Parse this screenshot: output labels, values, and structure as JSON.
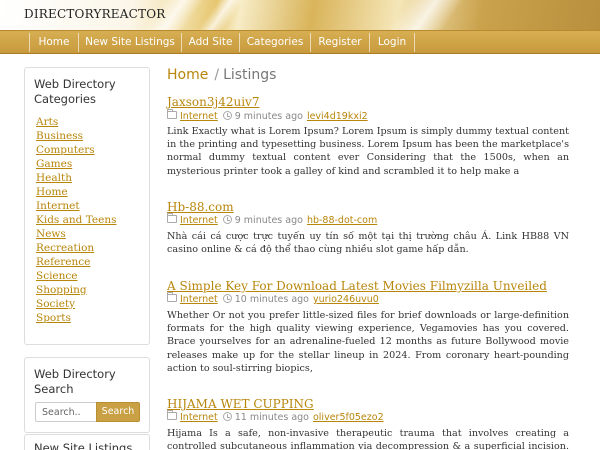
{
  "site": {
    "brand": "DIRECTORYREACTOR"
  },
  "nav": {
    "items": [
      "Home",
      "New Site Listings",
      "Add Site",
      "Categories",
      "Register",
      "Login"
    ]
  },
  "sidebar": {
    "categories_title_line1": "Web Directory",
    "categories_title_line2": "Categories",
    "categories": [
      "Arts",
      "Business",
      "Computers",
      "Games",
      "Health",
      "Home",
      "Internet",
      "Kids and Teens",
      "News",
      "Recreation",
      "Reference",
      "Science",
      "Shopping",
      "Society",
      "Sports"
    ],
    "search_title_line1": "Web Directory",
    "search_title_line2": "Search",
    "search_placeholder": "Search..",
    "search_button": "Search",
    "new_listings_title": "New Site Listings"
  },
  "breadcrumb": {
    "home": "Home",
    "separator": "/",
    "current": "Listings"
  },
  "listings": [
    {
      "title": "Jaxson3j42uiv7",
      "category": "Internet",
      "time": "9 minutes ago",
      "user": "levi4d19kxi2",
      "description": "Link Exactly what is Lorem Ipsum? Lorem Ipsum is simply dummy textual content in the printing and typesetting business. Lorem Ipsum has been the marketplace's normal dummy textual content ever Considering that the 1500s, when an mysterious printer took a galley of kind and scrambled it to help make a"
    },
    {
      "title": "Hb-88.com",
      "category": "Internet",
      "time": "9 minutes ago",
      "user": "hb-88-dot-com",
      "description": "Nhà cái cá cược trực tuyến uy tín số một tại thị trường châu Á. Link HB88 VN casino online & cá độ thể thao cùng nhiều slot game hấp dẫn."
    },
    {
      "title": "A Simple Key For Download Latest Movies Filmyzilla Unveiled",
      "category": "Internet",
      "time": "10 minutes ago",
      "user": "yurio246uvu0",
      "description": "Whether Or not you prefer little-sized files for brief downloads or large-definition formats for the high quality viewing experience, Vegamovies has you covered. Brace yourselves for an adrenaline-fueled 12 months as future Bollywood movie releases make up for the stellar lineup in 2024. From coronary heart-pounding action to soul-stirring biopics,"
    },
    {
      "title": "HIJAMA WET CUPPING",
      "category": "Internet",
      "time": "11 minutes ago",
      "user": "oliver5f05ezo2",
      "description": "Hijama Is a safe, non-invasive therapeutic trauma that involves creating a controlled subcutaneous inflammation via decompression & a superficial incision. In"
    }
  ],
  "colors": {
    "gold": "#c9a043",
    "link": "#b8860b",
    "nav_text": "#ffffff"
  },
  "icons": {
    "category": "folder-icon",
    "time": "clock-icon"
  }
}
